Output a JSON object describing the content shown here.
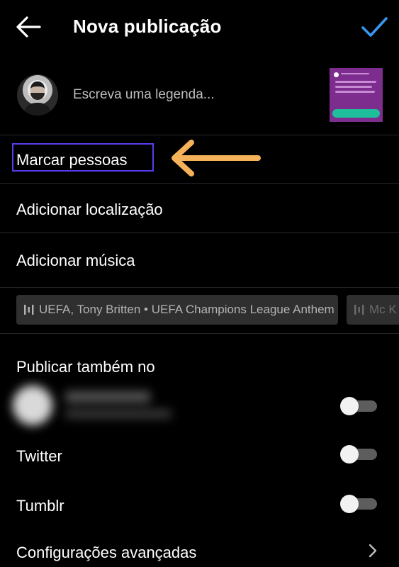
{
  "header": {
    "title": "Nova publicação",
    "back_icon": "arrow-left-icon",
    "confirm_icon": "checkmark-icon",
    "confirm_color": "#3897f0"
  },
  "caption": {
    "placeholder": "Escreva uma legenda...",
    "avatar": "profile-avatar",
    "thumbnail_color": "#7d2d8e"
  },
  "menu": {
    "tag_people": "Marcar pessoas",
    "add_location": "Adicionar localização",
    "add_music": "Adicionar música"
  },
  "annotation": {
    "highlight_color": "#5b3cf0",
    "arrow_color": "#f6b25a"
  },
  "music_suggestions": [
    {
      "text": "UEFA, Tony Britten • UEFA Champions League Anthem"
    },
    {
      "text": "Mc K"
    }
  ],
  "share": {
    "title": "Publicar também no",
    "accounts": [
      {
        "label": "",
        "enabled": false
      },
      {
        "label": "Twitter",
        "enabled": false
      },
      {
        "label": "Tumblr",
        "enabled": false
      }
    ]
  },
  "advanced": {
    "label": "Configurações avançadas"
  }
}
